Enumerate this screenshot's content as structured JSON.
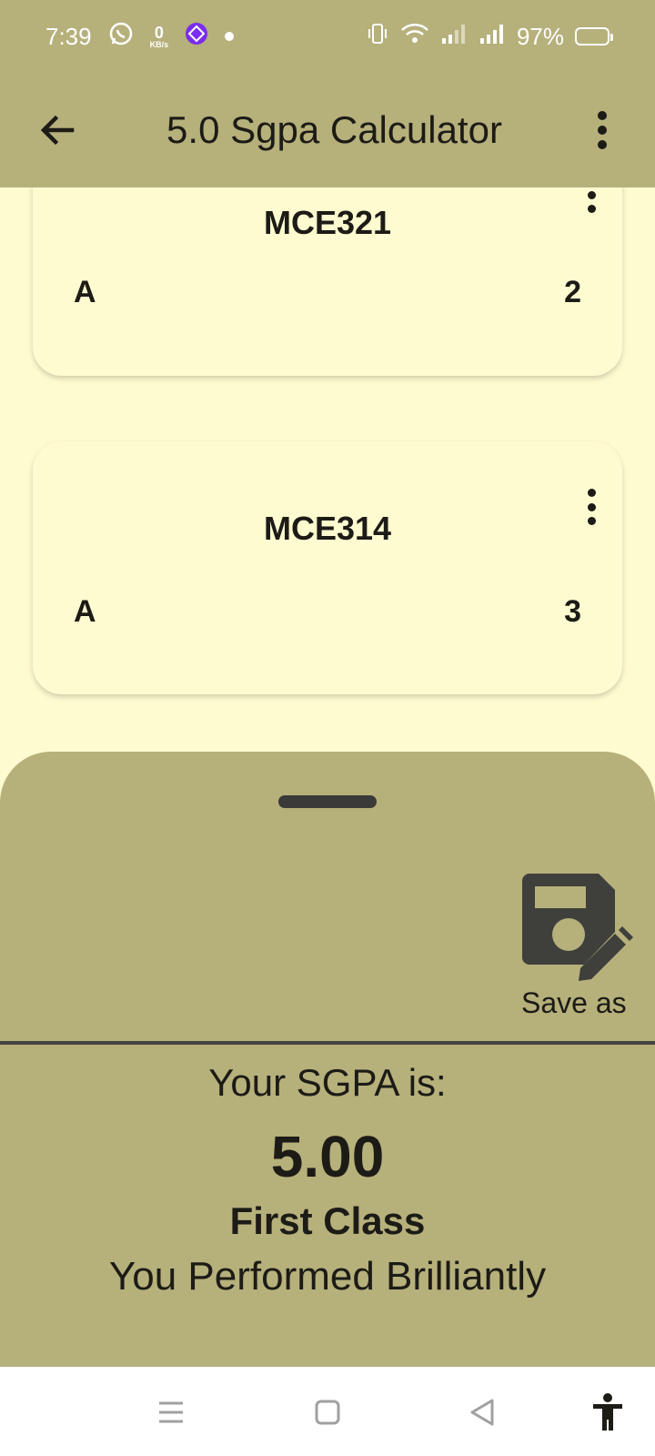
{
  "status_bar": {
    "time": "7:39",
    "net_speed_value": "0",
    "net_speed_unit": "KB/s",
    "battery": "97%",
    "icons": [
      "whatsapp-icon",
      "app-icon",
      "notification-dot",
      "vibrate-icon",
      "wifi-icon",
      "signal-icon",
      "signal-icon",
      "battery-icon"
    ]
  },
  "app_bar": {
    "title": "5.0 Sgpa Calculator",
    "back_icon": "arrow-back-icon",
    "menu_icon": "more-vert-icon"
  },
  "courses": [
    {
      "code": "MCE321",
      "grade": "A",
      "units": "2"
    },
    {
      "code": "MCE314",
      "grade": "A",
      "units": "3"
    }
  ],
  "sheet": {
    "save_label": "Save as",
    "save_icon": "save-edit-icon",
    "result_label": "Your SGPA is:",
    "sgpa": "5.00",
    "class": "First Class",
    "remark": "You Performed Brilliantly"
  },
  "nav": {
    "icons": [
      "menu-icon",
      "home-square-icon",
      "back-triangle-icon",
      "accessibility-icon"
    ]
  },
  "colors": {
    "primary": "#b6b07b",
    "background": "#fffbd0",
    "text": "#1c1b16",
    "battery": "#f5c518",
    "app_icon": "#7b2cf0"
  }
}
